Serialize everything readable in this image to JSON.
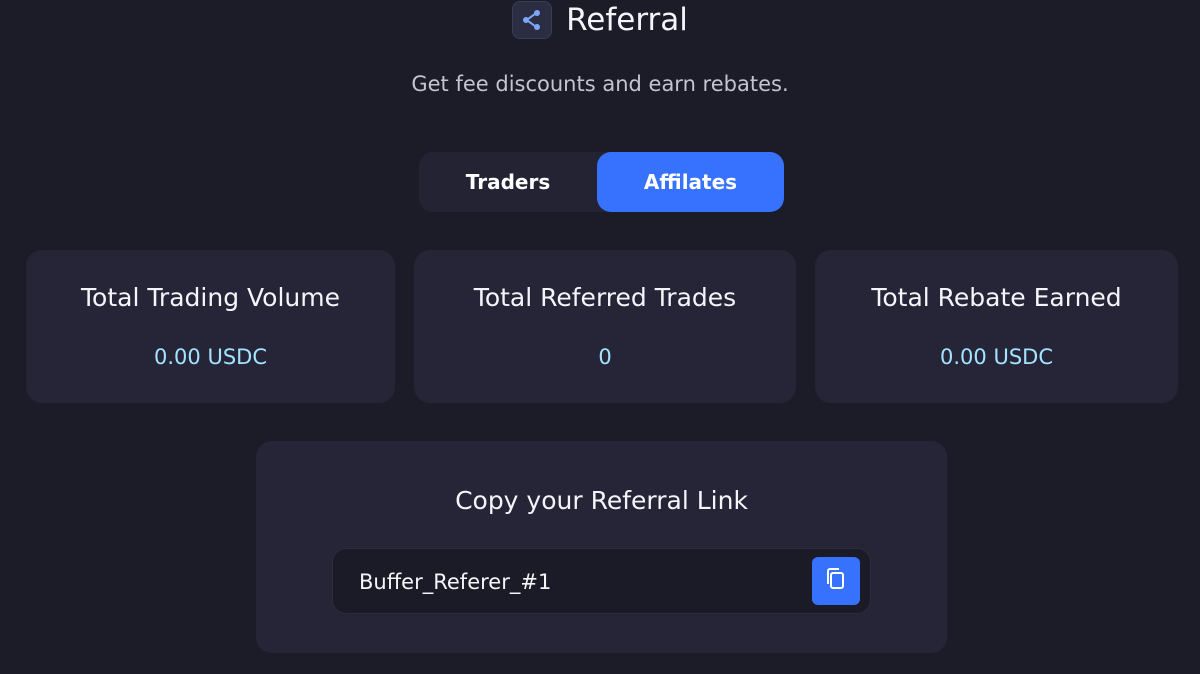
{
  "header": {
    "title": "Referral",
    "icon": "share-icon",
    "subtitle": "Get fee discounts and earn rebates."
  },
  "tabs": [
    {
      "label": "Traders",
      "active": false
    },
    {
      "label": "Affilates",
      "active": true
    }
  ],
  "stats": [
    {
      "label": "Total Trading Volume",
      "value": "0.00 USDC"
    },
    {
      "label": "Total Referred Trades",
      "value": "0"
    },
    {
      "label": "Total Rebate Earned",
      "value": "0.00 USDC"
    }
  ],
  "referral_link": {
    "title": "Copy your Referral Link",
    "value": "Buffer_Referer_#1",
    "copy_icon": "copy-icon"
  },
  "colors": {
    "background": "#1c1c29",
    "card": "#252537",
    "accent": "#3772ff",
    "value_text": "#a3e3ff"
  }
}
